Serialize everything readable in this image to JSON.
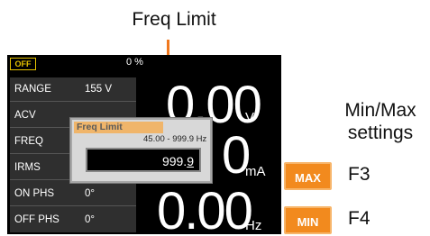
{
  "annotations": {
    "freq_limit": "Freq Limit",
    "minmax_line1": "Min/Max",
    "minmax_line2": "settings",
    "f3": "F3",
    "f4": "F4"
  },
  "status": {
    "output_state": "OFF",
    "percent": "0 %"
  },
  "params": [
    {
      "name": "RANGE",
      "value": "155 V"
    },
    {
      "name": "ACV",
      "value": ""
    },
    {
      "name": "FREQ",
      "value": ""
    },
    {
      "name": "IRMS",
      "value": ""
    },
    {
      "name": "ON PHS",
      "value": "0°"
    },
    {
      "name": "OFF PHS",
      "value": "0°"
    }
  ],
  "readings": {
    "voltage": "0.00",
    "voltage_unit": "V",
    "current": "0",
    "current_unit": "mA",
    "frequency": "0.00",
    "frequency_unit": "Hz"
  },
  "dialog": {
    "title": "Freq Limit",
    "range": "45.00 - 999.9 Hz",
    "value": "999.9",
    "value_main": "999.",
    "value_cursor": "9"
  },
  "softkeys": {
    "max_label": "MAX",
    "min_label": "MIN"
  },
  "colors": {
    "accent": "#f28a1e",
    "status_yellow": "#e6c200",
    "panel_bg": "#2f2f2f",
    "screen_bg": "#000000"
  }
}
